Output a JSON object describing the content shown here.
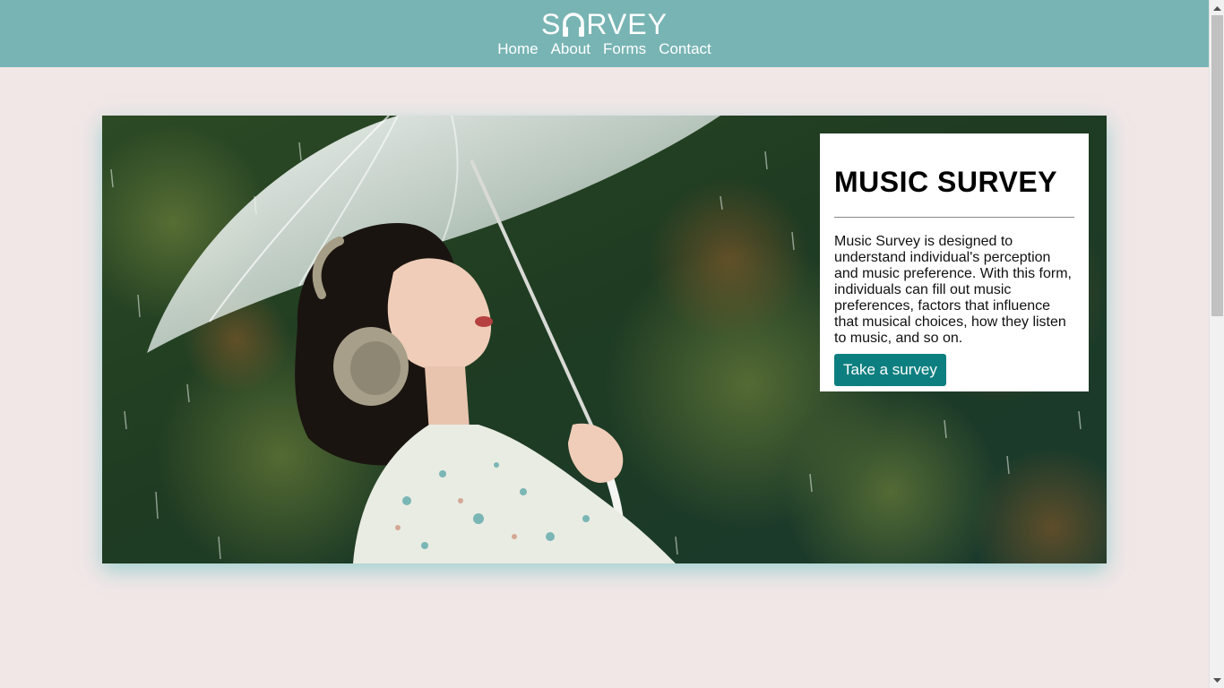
{
  "header": {
    "logo_left": "S",
    "logo_right": "RVEY",
    "logo_icon": "headphones-icon",
    "nav": [
      "Home",
      "About",
      "Forms",
      "Contact"
    ]
  },
  "hero": {
    "image": "woman-with-headphones-and-umbrella-in-rain"
  },
  "card": {
    "title": "MUSIC SURVEY",
    "description": "Music Survey is designed to understand individual's perception and music preference. With this form, individuals can fill out music preferences, factors that influence that musical choices, how they listen to music, and so on.",
    "button_label": "Take a survey"
  },
  "colors": {
    "header_bg": "#78b4b4",
    "page_bg": "#f1e7e7",
    "button_bg": "#0e7f80"
  }
}
